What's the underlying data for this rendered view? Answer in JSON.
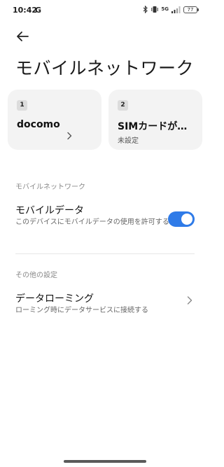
{
  "status_bar": {
    "time": "10:42",
    "app_icon_letter": "G",
    "network": "5G",
    "battery_level": "77"
  },
  "header": {
    "title": "モバイルネットワーク"
  },
  "sim_cards": [
    {
      "slot": "1",
      "name": "docomo",
      "status": ""
    },
    {
      "slot": "2",
      "name": "SIMカードが…",
      "status": "未設定"
    }
  ],
  "sections": {
    "mobile_network": {
      "label": "モバイルネットワーク",
      "mobile_data": {
        "title": "モバイルデータ",
        "description": "このデバイスにモバイルデータの使用を許可する",
        "enabled": true
      }
    },
    "other_settings": {
      "label": "その他の設定",
      "data_roaming": {
        "title": "データローミング",
        "description": "ローミング時にデータサービスに接続する"
      }
    }
  },
  "colors": {
    "accent": "#2f7be8",
    "card_bg": "#f3f3f3"
  }
}
